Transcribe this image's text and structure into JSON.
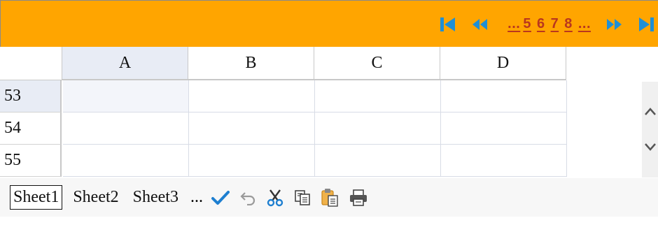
{
  "pager": {
    "pages": [
      "5",
      "6",
      "7",
      "8"
    ],
    "leading_ellipsis": "...",
    "trailing_ellipsis": "...",
    "accent": "#1e8fd6",
    "link_color": "#b9371e"
  },
  "grid": {
    "columns": [
      "A",
      "B",
      "C",
      "D"
    ],
    "rows": [
      "53",
      "54",
      "55"
    ],
    "active_column": "A",
    "active_row": "53"
  },
  "tabs": {
    "sheets": [
      "Sheet1",
      "Sheet2",
      "Sheet3"
    ],
    "active_sheet": "Sheet1",
    "more": "..."
  },
  "toolbar": {
    "icons": [
      "check-icon",
      "undo-icon",
      "cut-icon",
      "copy-icon",
      "paste-icon",
      "print-icon"
    ]
  },
  "colors": {
    "header_bar": "#ffa500",
    "active_header": "#e8ecf5"
  }
}
